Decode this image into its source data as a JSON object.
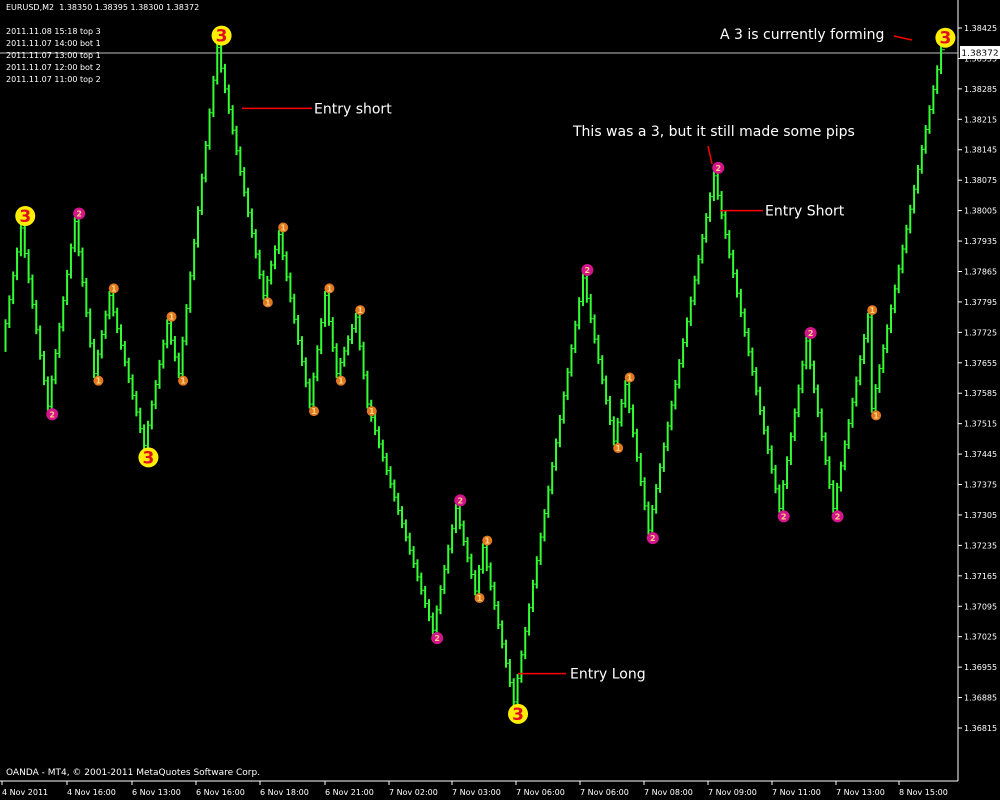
{
  "header": {
    "symbol": "EURUSD,M2",
    "ohlc": "1.38350 1.38395 1.38300 1.38372"
  },
  "signal_log": [
    "2011.11.08 15:18 top 3",
    "2011.11.07 14:00 bot 1",
    "2011.11.07 13:00 top 1",
    "2011.11.07 12:00 bot 2",
    "2011.11.07 11:00 top 2"
  ],
  "copyright": "OANDA - MT4, © 2001-2011 MetaQuotes Software Corp.",
  "colors": {
    "background": "#000000",
    "bars": "#33ff33",
    "grade1": "#e07820",
    "grade2": "#d4148c",
    "grade3": "#ffee00",
    "annotation_line": "#ff0000",
    "text": "#ffffff"
  },
  "chart_data": {
    "type": "line",
    "title": "EURUSD,M2",
    "current_price": "1.38372",
    "ylim": [
      1.3678,
      1.385
    ],
    "y_ticks": [
      "1.38425",
      "1.38355",
      "1.38285",
      "1.38215",
      "1.38145",
      "1.38075",
      "1.38005",
      "1.37935",
      "1.37865",
      "1.37795",
      "1.37725",
      "1.37655",
      "1.37585",
      "1.37515",
      "1.37445",
      "1.37375",
      "1.37305",
      "1.37235",
      "1.37165",
      "1.37095",
      "1.37025",
      "1.36955",
      "1.36885",
      "1.36815"
    ],
    "x_ticks": [
      "4 Nov 2011",
      "4 Nov 16:00",
      "6 Nov 13:00",
      "6 Nov 16:00",
      "6 Nov 18:00",
      "6 Nov 21:00",
      "7 Nov 02:00",
      "7 Nov 03:00",
      "7 Nov 06:00",
      "7 Nov 06:00",
      "7 Nov 08:00",
      "7 Nov 09:00",
      "7 Nov 11:00",
      "7 Nov 13:00",
      "8 Nov 15:00"
    ],
    "swings": [
      {
        "bar": 0,
        "price": 1.3769
      },
      {
        "bar": 5,
        "price": 1.37965,
        "grade": 3
      },
      {
        "bar": 12,
        "price": 1.37555,
        "grade": 2
      },
      {
        "bar": 19,
        "price": 1.3798,
        "grade": 2
      },
      {
        "bar": 24,
        "price": 1.3763,
        "grade": 1
      },
      {
        "bar": 28,
        "price": 1.3781,
        "grade": 1
      },
      {
        "bar": 37,
        "price": 1.37465,
        "grade": 3
      },
      {
        "bar": 43,
        "price": 1.37745,
        "grade": 1
      },
      {
        "bar": 46,
        "price": 1.3763,
        "grade": 1
      },
      {
        "bar": 56,
        "price": 1.3838,
        "grade": 3
      },
      {
        "bar": 68,
        "price": 1.3781,
        "grade": 1
      },
      {
        "bar": 72,
        "price": 1.3795,
        "grade": 1
      },
      {
        "bar": 80,
        "price": 1.3756,
        "grade": 1
      },
      {
        "bar": 84,
        "price": 1.3781,
        "grade": 1
      },
      {
        "bar": 87,
        "price": 1.3763,
        "grade": 1
      },
      {
        "bar": 92,
        "price": 1.3776,
        "grade": 1
      },
      {
        "bar": 95,
        "price": 1.3756,
        "grade": 1
      },
      {
        "bar": 112,
        "price": 1.3704,
        "grade": 2
      },
      {
        "bar": 118,
        "price": 1.3732,
        "grade": 2
      },
      {
        "bar": 123,
        "price": 1.3713,
        "grade": 1
      },
      {
        "bar": 125,
        "price": 1.3723,
        "grade": 1
      },
      {
        "bar": 133,
        "price": 1.36875,
        "grade": 3
      },
      {
        "bar": 151,
        "price": 1.3785,
        "grade": 2
      },
      {
        "bar": 159,
        "price": 1.37475,
        "grade": 1
      },
      {
        "bar": 162,
        "price": 1.37605,
        "grade": 1
      },
      {
        "bar": 168,
        "price": 1.3727,
        "grade": 2
      },
      {
        "bar": 185,
        "price": 1.38085,
        "grade": 2
      },
      {
        "bar": 202,
        "price": 1.3732,
        "grade": 2
      },
      {
        "bar": 209,
        "price": 1.37705,
        "grade": 2
      },
      {
        "bar": 216,
        "price": 1.3732,
        "grade": 2
      },
      {
        "bar": 226,
        "price": 1.3755,
        "grade": 1
      },
      {
        "bar": 225,
        "price": 1.3776,
        "grade": 1
      },
      {
        "bar": 244,
        "price": 1.38375,
        "grade": 3
      }
    ],
    "annotations": [
      {
        "text": "Entry short",
        "price": 1.3824
      },
      {
        "text": "Entry Short",
        "price": 1.38005
      },
      {
        "text": "Entry Long",
        "price": 1.3694
      },
      {
        "text": "This was a 3, but it still made some pips",
        "price": 1.381
      },
      {
        "text": "A 3 is currently forming",
        "price": 1.38375
      }
    ]
  }
}
